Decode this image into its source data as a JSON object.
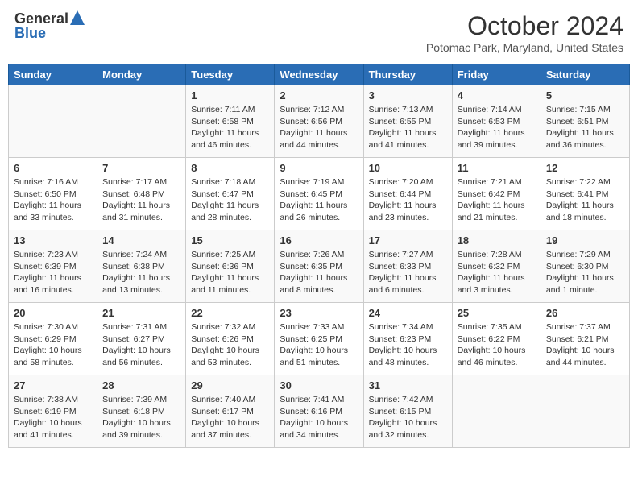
{
  "logo": {
    "general": "General",
    "blue": "Blue"
  },
  "title": "October 2024",
  "location": "Potomac Park, Maryland, United States",
  "days_of_week": [
    "Sunday",
    "Monday",
    "Tuesday",
    "Wednesday",
    "Thursday",
    "Friday",
    "Saturday"
  ],
  "weeks": [
    [
      {
        "day": "",
        "content": ""
      },
      {
        "day": "",
        "content": ""
      },
      {
        "day": "1",
        "content": "Sunrise: 7:11 AM\nSunset: 6:58 PM\nDaylight: 11 hours and 46 minutes."
      },
      {
        "day": "2",
        "content": "Sunrise: 7:12 AM\nSunset: 6:56 PM\nDaylight: 11 hours and 44 minutes."
      },
      {
        "day": "3",
        "content": "Sunrise: 7:13 AM\nSunset: 6:55 PM\nDaylight: 11 hours and 41 minutes."
      },
      {
        "day": "4",
        "content": "Sunrise: 7:14 AM\nSunset: 6:53 PM\nDaylight: 11 hours and 39 minutes."
      },
      {
        "day": "5",
        "content": "Sunrise: 7:15 AM\nSunset: 6:51 PM\nDaylight: 11 hours and 36 minutes."
      }
    ],
    [
      {
        "day": "6",
        "content": "Sunrise: 7:16 AM\nSunset: 6:50 PM\nDaylight: 11 hours and 33 minutes."
      },
      {
        "day": "7",
        "content": "Sunrise: 7:17 AM\nSunset: 6:48 PM\nDaylight: 11 hours and 31 minutes."
      },
      {
        "day": "8",
        "content": "Sunrise: 7:18 AM\nSunset: 6:47 PM\nDaylight: 11 hours and 28 minutes."
      },
      {
        "day": "9",
        "content": "Sunrise: 7:19 AM\nSunset: 6:45 PM\nDaylight: 11 hours and 26 minutes."
      },
      {
        "day": "10",
        "content": "Sunrise: 7:20 AM\nSunset: 6:44 PM\nDaylight: 11 hours and 23 minutes."
      },
      {
        "day": "11",
        "content": "Sunrise: 7:21 AM\nSunset: 6:42 PM\nDaylight: 11 hours and 21 minutes."
      },
      {
        "day": "12",
        "content": "Sunrise: 7:22 AM\nSunset: 6:41 PM\nDaylight: 11 hours and 18 minutes."
      }
    ],
    [
      {
        "day": "13",
        "content": "Sunrise: 7:23 AM\nSunset: 6:39 PM\nDaylight: 11 hours and 16 minutes."
      },
      {
        "day": "14",
        "content": "Sunrise: 7:24 AM\nSunset: 6:38 PM\nDaylight: 11 hours and 13 minutes."
      },
      {
        "day": "15",
        "content": "Sunrise: 7:25 AM\nSunset: 6:36 PM\nDaylight: 11 hours and 11 minutes."
      },
      {
        "day": "16",
        "content": "Sunrise: 7:26 AM\nSunset: 6:35 PM\nDaylight: 11 hours and 8 minutes."
      },
      {
        "day": "17",
        "content": "Sunrise: 7:27 AM\nSunset: 6:33 PM\nDaylight: 11 hours and 6 minutes."
      },
      {
        "day": "18",
        "content": "Sunrise: 7:28 AM\nSunset: 6:32 PM\nDaylight: 11 hours and 3 minutes."
      },
      {
        "day": "19",
        "content": "Sunrise: 7:29 AM\nSunset: 6:30 PM\nDaylight: 11 hours and 1 minute."
      }
    ],
    [
      {
        "day": "20",
        "content": "Sunrise: 7:30 AM\nSunset: 6:29 PM\nDaylight: 10 hours and 58 minutes."
      },
      {
        "day": "21",
        "content": "Sunrise: 7:31 AM\nSunset: 6:27 PM\nDaylight: 10 hours and 56 minutes."
      },
      {
        "day": "22",
        "content": "Sunrise: 7:32 AM\nSunset: 6:26 PM\nDaylight: 10 hours and 53 minutes."
      },
      {
        "day": "23",
        "content": "Sunrise: 7:33 AM\nSunset: 6:25 PM\nDaylight: 10 hours and 51 minutes."
      },
      {
        "day": "24",
        "content": "Sunrise: 7:34 AM\nSunset: 6:23 PM\nDaylight: 10 hours and 48 minutes."
      },
      {
        "day": "25",
        "content": "Sunrise: 7:35 AM\nSunset: 6:22 PM\nDaylight: 10 hours and 46 minutes."
      },
      {
        "day": "26",
        "content": "Sunrise: 7:37 AM\nSunset: 6:21 PM\nDaylight: 10 hours and 44 minutes."
      }
    ],
    [
      {
        "day": "27",
        "content": "Sunrise: 7:38 AM\nSunset: 6:19 PM\nDaylight: 10 hours and 41 minutes."
      },
      {
        "day": "28",
        "content": "Sunrise: 7:39 AM\nSunset: 6:18 PM\nDaylight: 10 hours and 39 minutes."
      },
      {
        "day": "29",
        "content": "Sunrise: 7:40 AM\nSunset: 6:17 PM\nDaylight: 10 hours and 37 minutes."
      },
      {
        "day": "30",
        "content": "Sunrise: 7:41 AM\nSunset: 6:16 PM\nDaylight: 10 hours and 34 minutes."
      },
      {
        "day": "31",
        "content": "Sunrise: 7:42 AM\nSunset: 6:15 PM\nDaylight: 10 hours and 32 minutes."
      },
      {
        "day": "",
        "content": ""
      },
      {
        "day": "",
        "content": ""
      }
    ]
  ]
}
